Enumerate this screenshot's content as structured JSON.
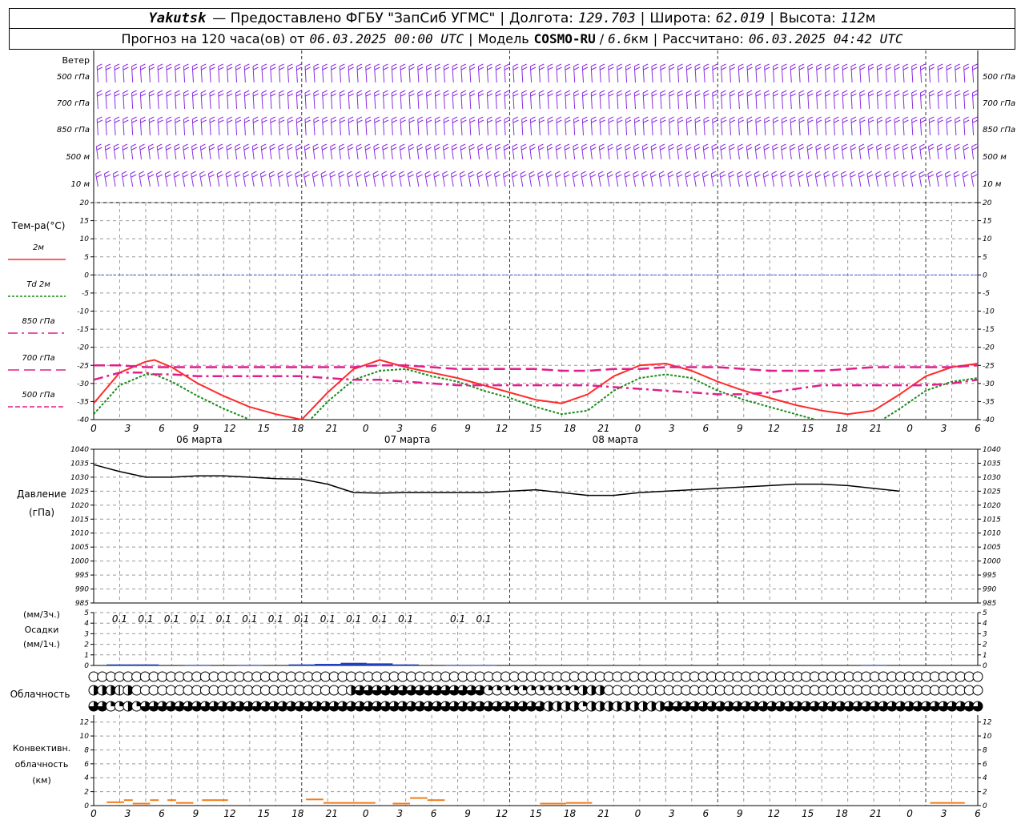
{
  "header": {
    "station": "Yakutsk",
    "provider": "— Предоставлено ФГБУ \"ЗапСиб УГМС\"",
    "lon_label": "Долгота:",
    "lon_value": "129.703",
    "lat_label": "Широта:",
    "lat_value": "62.019",
    "alt_label": "Высота:",
    "alt_value": "112",
    "alt_unit": "м",
    "forecast_label": "Прогноз на 120 часа(ов) от",
    "forecast_start": "06.03.2025 00:00 UTC",
    "model_label": "Модель",
    "model_name": "COSMO-RU",
    "model_res": "6.6",
    "model_res_unit": "км",
    "calc_label": "Рассчитано:",
    "calc_time": "06.03.2025 04:42 UTC"
  },
  "colors": {
    "wind": "#8a2be2",
    "t2m": "#ff2a2a",
    "td2m": "#1a8a1a",
    "t850": "#e01e8c",
    "t700": "#e01e8c",
    "t500": "#e01e8c",
    "pressure": "#000000",
    "precip": "#1f3fbf",
    "conv": "#f07d1a",
    "grid": "#999999",
    "zero": "#3b5bdb"
  },
  "chart_data": [
    {
      "type": "barbs",
      "panel": "wind",
      "title": "Ветер",
      "levels": [
        "500 гПа",
        "700 гПа",
        "850 гПа",
        "500 м",
        "10  м"
      ]
    },
    {
      "type": "line",
      "panel": "temperature",
      "title": "Тем-ра(°C)",
      "ylim": [
        -40,
        20
      ],
      "yticks": [
        20,
        15,
        10,
        5,
        0,
        -5,
        -10,
        -15,
        -20,
        -25,
        -30,
        -35,
        -40
      ],
      "x_hours": [
        0,
        3,
        6,
        7,
        9,
        12,
        15,
        18,
        21,
        24,
        27,
        30,
        33,
        36,
        39,
        42,
        45,
        48,
        51,
        54,
        57,
        60,
        63,
        66,
        69,
        72
      ],
      "series": [
        {
          "name": "2м",
          "key": "t2m",
          "style": "solid",
          "values": [
            -35.5,
            -27,
            -24,
            -23.5,
            -25.5,
            -30,
            -33.5,
            -36.5,
            -38.5,
            -40,
            -32.5,
            -26,
            -23.5,
            -25.5,
            -27,
            -28.5,
            -30.5,
            -32.5,
            -34.5,
            -35.5,
            -33,
            -28,
            -25,
            -24.5,
            -26.5,
            -29.5
          ]
        },
        {
          "name": "Td 2м",
          "key": "td2m",
          "style": "dotted",
          "values": [
            -38.5,
            -30.5,
            -27.5,
            -27.5,
            -29.5,
            -33.5,
            -37,
            -40,
            -41.5,
            -42.5,
            -35,
            -29,
            -26.5,
            -26,
            -28,
            -29.5,
            -32,
            -34,
            -36.5,
            -38.5,
            -37.5,
            -32,
            -28.5,
            -27.5,
            -28.5,
            -32
          ]
        },
        {
          "name": "850 гПа",
          "key": "t850",
          "style": "dashdot",
          "values": [
            -29,
            -27,
            -27,
            -27.5,
            -27.5,
            -28,
            -28,
            -28,
            -28,
            -28,
            -28.5,
            -29,
            -29,
            -29.5,
            -30,
            -30.5,
            -30.5,
            -30.5,
            -30.5,
            -30.5,
            -30.5,
            -31,
            -31.5,
            -32,
            -32.5,
            -33
          ]
        },
        {
          "name": "700 гПа",
          "key": "t700",
          "style": "dashed",
          "values": [
            -25,
            -25,
            -25.5,
            -25.5,
            -25.5,
            -25.5,
            -25.5,
            -25.5,
            -25.5,
            -25.5,
            -25.5,
            -25.5,
            -25,
            -25,
            -25.5,
            -26,
            -26,
            -26,
            -26,
            -26.5,
            -26.5,
            -26,
            -26,
            -25.5,
            -25.5,
            -25.5
          ]
        }
      ],
      "x_after": [
        72,
        75,
        78,
        81,
        84,
        87,
        90,
        93,
        96,
        99,
        102
      ],
      "series_after": [
        {
          "key": "t2m",
          "values": [
            -29.5,
            -32,
            -34,
            -36,
            -37.5,
            -38.5,
            -37.5,
            -33,
            -28,
            -25.5,
            -24.5
          ]
        },
        {
          "key": "td2m",
          "values": [
            -32,
            -34.5,
            -36.5,
            -38.5,
            -40.5,
            -42,
            -41.5,
            -37,
            -32,
            -29.5,
            -28.5
          ]
        },
        {
          "key": "t850",
          "values": [
            -33,
            -33,
            -32.5,
            -31.5,
            -30.5,
            -30.5,
            -30.5,
            -30.5,
            -30.5,
            -30,
            -29
          ]
        },
        {
          "key": "t700",
          "values": [
            -25.5,
            -26,
            -26.5,
            -26.5,
            -26.5,
            -26,
            -25.5,
            -25.5,
            -25.5,
            -25.5,
            -25
          ]
        }
      ]
    },
    {
      "type": "line",
      "panel": "pressure",
      "title": "Давление",
      "unit": "(гПа)",
      "ylim": [
        985,
        1040
      ],
      "yticks": [
        1040,
        1035,
        1030,
        1025,
        1020,
        1015,
        1010,
        1005,
        1000,
        995,
        990,
        985
      ],
      "x_hours": [
        0,
        3,
        6,
        9,
        12,
        15,
        18,
        21,
        24,
        27,
        30,
        33,
        36,
        39,
        42,
        45,
        48,
        51,
        54,
        57,
        60,
        63,
        66,
        69,
        72,
        75,
        78,
        81,
        84,
        87,
        90,
        93,
        96,
        99,
        102
      ],
      "values": [
        1034.5,
        1032,
        1030,
        1030,
        1030.5,
        1030.5,
        1030,
        1029.5,
        1029.3,
        1027.5,
        1024.5,
        1024.3,
        1024.5,
        1024.5,
        1024.5,
        1024.5,
        1025,
        1025.5,
        1024.5,
        1023.5,
        1023.5,
        1024.5,
        1025,
        1025.5,
        1026,
        1026.5,
        1027,
        1027.5,
        1027.5,
        1027,
        1026,
        1025
      ]
    },
    {
      "type": "bar",
      "panel": "precip",
      "title": "Осадки",
      "unit_top": "(мм/3ч.)",
      "unit_bottom": "(мм/1ч.)",
      "ylim": [
        0,
        5
      ],
      "yticks": [
        5,
        4,
        3,
        2,
        1,
        0
      ],
      "label_hours": [
        3,
        6,
        9,
        12,
        15,
        18,
        21,
        24,
        27,
        30,
        33,
        36,
        42,
        45
      ],
      "labels": [
        "0.1",
        "0.1",
        "0.1",
        "0.1",
        "0.1",
        "0.1",
        "0.1",
        "0.1",
        "0.1",
        "0.1",
        "0.1",
        "0.1",
        "0.1",
        "0.1"
      ],
      "bar_hours": [
        3,
        6,
        12,
        18,
        24,
        27,
        30,
        33,
        36,
        42,
        45,
        90
      ],
      "bar_values": [
        0.1,
        0.1,
        0.05,
        0.05,
        0.1,
        0.15,
        0.25,
        0.2,
        0.1,
        0.05,
        0.05,
        0.05
      ]
    },
    {
      "type": "symbols",
      "panel": "clouds",
      "title": "Облачность",
      "rows": [
        "000000000000000000000000000000000000000000000000000000000000000000000000000000000000000000000000000000000",
        "3331300000000000000000000000003444444444444444222222222223330000000000000000000000000000000000000000000000",
        "4422324444444444444444444444444444444444444444444444433332333333333444444444444444444444444444444444444444"
      ]
    },
    {
      "type": "bar",
      "panel": "convective",
      "title": "Конвективн.",
      "title2": "облачность",
      "unit": "(км)",
      "ylim": [
        0,
        13
      ],
      "yticks": [
        12,
        10,
        8,
        6,
        4,
        2,
        0
      ],
      "segments": [
        {
          "from": 1.5,
          "to": 3.5,
          "value": 0.6
        },
        {
          "from": 3.5,
          "to": 4.5,
          "value": 0.9
        },
        {
          "from": 4.5,
          "to": 6.5,
          "value": 0.4
        },
        {
          "from": 6.5,
          "to": 7.5,
          "value": 0.9
        },
        {
          "from": 8.5,
          "to": 9.5,
          "value": 0.9
        },
        {
          "from": 9.5,
          "to": 11.5,
          "value": 0.5
        },
        {
          "from": 12.5,
          "to": 15.5,
          "value": 0.9
        },
        {
          "from": 24.5,
          "to": 26.5,
          "value": 1.0
        },
        {
          "from": 26.5,
          "to": 32.5,
          "value": 0.5
        },
        {
          "from": 34.5,
          "to": 36.5,
          "value": 0.4
        },
        {
          "from": 36.5,
          "to": 38.5,
          "value": 1.2
        },
        {
          "from": 38.5,
          "to": 40.5,
          "value": 0.9
        },
        {
          "from": 51.5,
          "to": 54.5,
          "value": 0.4
        },
        {
          "from": 54.5,
          "to": 57.5,
          "value": 0.5
        },
        {
          "from": 96.5,
          "to": 100.5,
          "value": 0.5
        }
      ]
    }
  ],
  "axis": {
    "hour_ticks": [
      "0",
      "3",
      "6",
      "9",
      "12",
      "15",
      "18",
      "21",
      "0",
      "3",
      "6",
      "9",
      "12",
      "15",
      "18",
      "21",
      "0",
      "3",
      "6",
      "9",
      "12",
      "15",
      "18",
      "21",
      "0",
      "3",
      "6"
    ],
    "days": [
      "06 марта",
      "07 марта",
      "08 марта"
    ]
  }
}
